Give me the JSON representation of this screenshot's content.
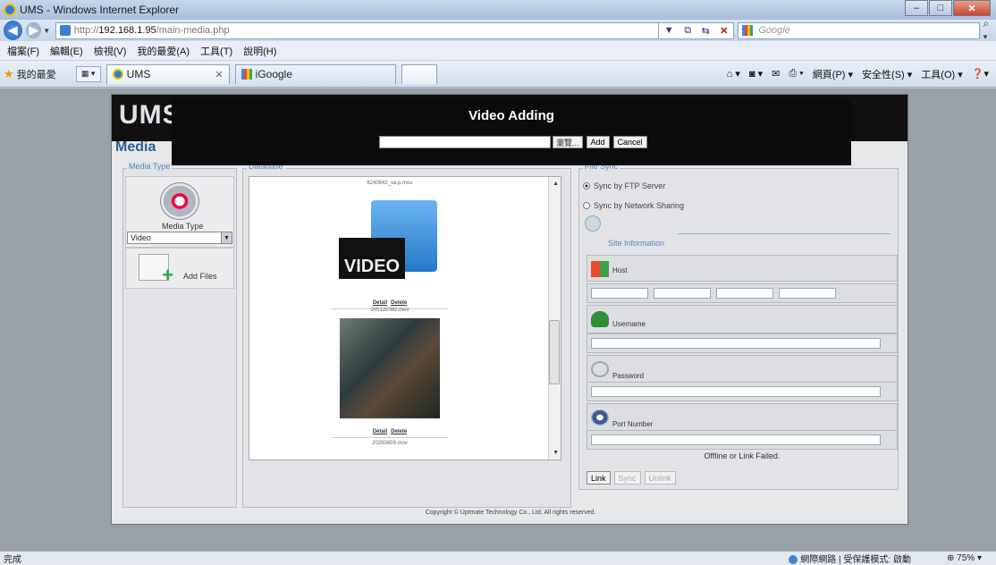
{
  "window": {
    "title": "UMS - Windows Internet Explorer"
  },
  "address": {
    "prefix": "http://",
    "host": "192.168.1.95",
    "path": "/main-media.php",
    "search_placeholder": "Google"
  },
  "menu": [
    "檔案(F)",
    "編輯(E)",
    "檢視(V)",
    "我的最愛(A)",
    "工具(T)",
    "說明(H)"
  ],
  "favorites": {
    "label": "我的最愛"
  },
  "tabs": [
    {
      "label": "UMS",
      "active": true
    },
    {
      "label": "iGoogle",
      "active": false
    }
  ],
  "commandbar": {
    "page": "網頁(P) ▾",
    "safety": "安全性(S) ▾",
    "tools": "工具(O) ▾"
  },
  "app": {
    "logo": "UMS",
    "section_title": "Media",
    "media_type_legend": "Media Type",
    "media_type_label": "Media Type",
    "media_type_selected": "Video",
    "add_files_label": "Add Files",
    "database_legend": "Database",
    "file_sync_legend": "File Sync",
    "items": [
      {
        "filename": "6240642_va.p.mov",
        "detail": "Detail",
        "delete": "Delete"
      },
      {
        "filename": "205120382.mov",
        "detail": "Detail",
        "delete": "Delete"
      },
      {
        "filename": "20280809.mov"
      }
    ],
    "sync": {
      "ftp_label": "Sync by FTP Server",
      "share_label": "Sync by Network Sharing",
      "selected": "ftp",
      "site_information": "Site Information",
      "host_label": "Host",
      "username_label": "Username",
      "password_label": "Password",
      "port_label": "Port Number",
      "status": "Offline or Link Failed.",
      "link_button": "Link",
      "sync_button": "Sync",
      "unlink_button": "Unlink"
    },
    "copyright": "Copyright © Uptmate Technology Co., Ltd. All rights reserved."
  },
  "modal": {
    "title": "Video Adding",
    "browse_label": "瀏覽...",
    "add_label": "Add",
    "cancel_label": "Cancel"
  },
  "statusbar": {
    "left": "完成",
    "zone": "網際網路 | 受保護模式: 啟動",
    "zoom": "75%"
  }
}
